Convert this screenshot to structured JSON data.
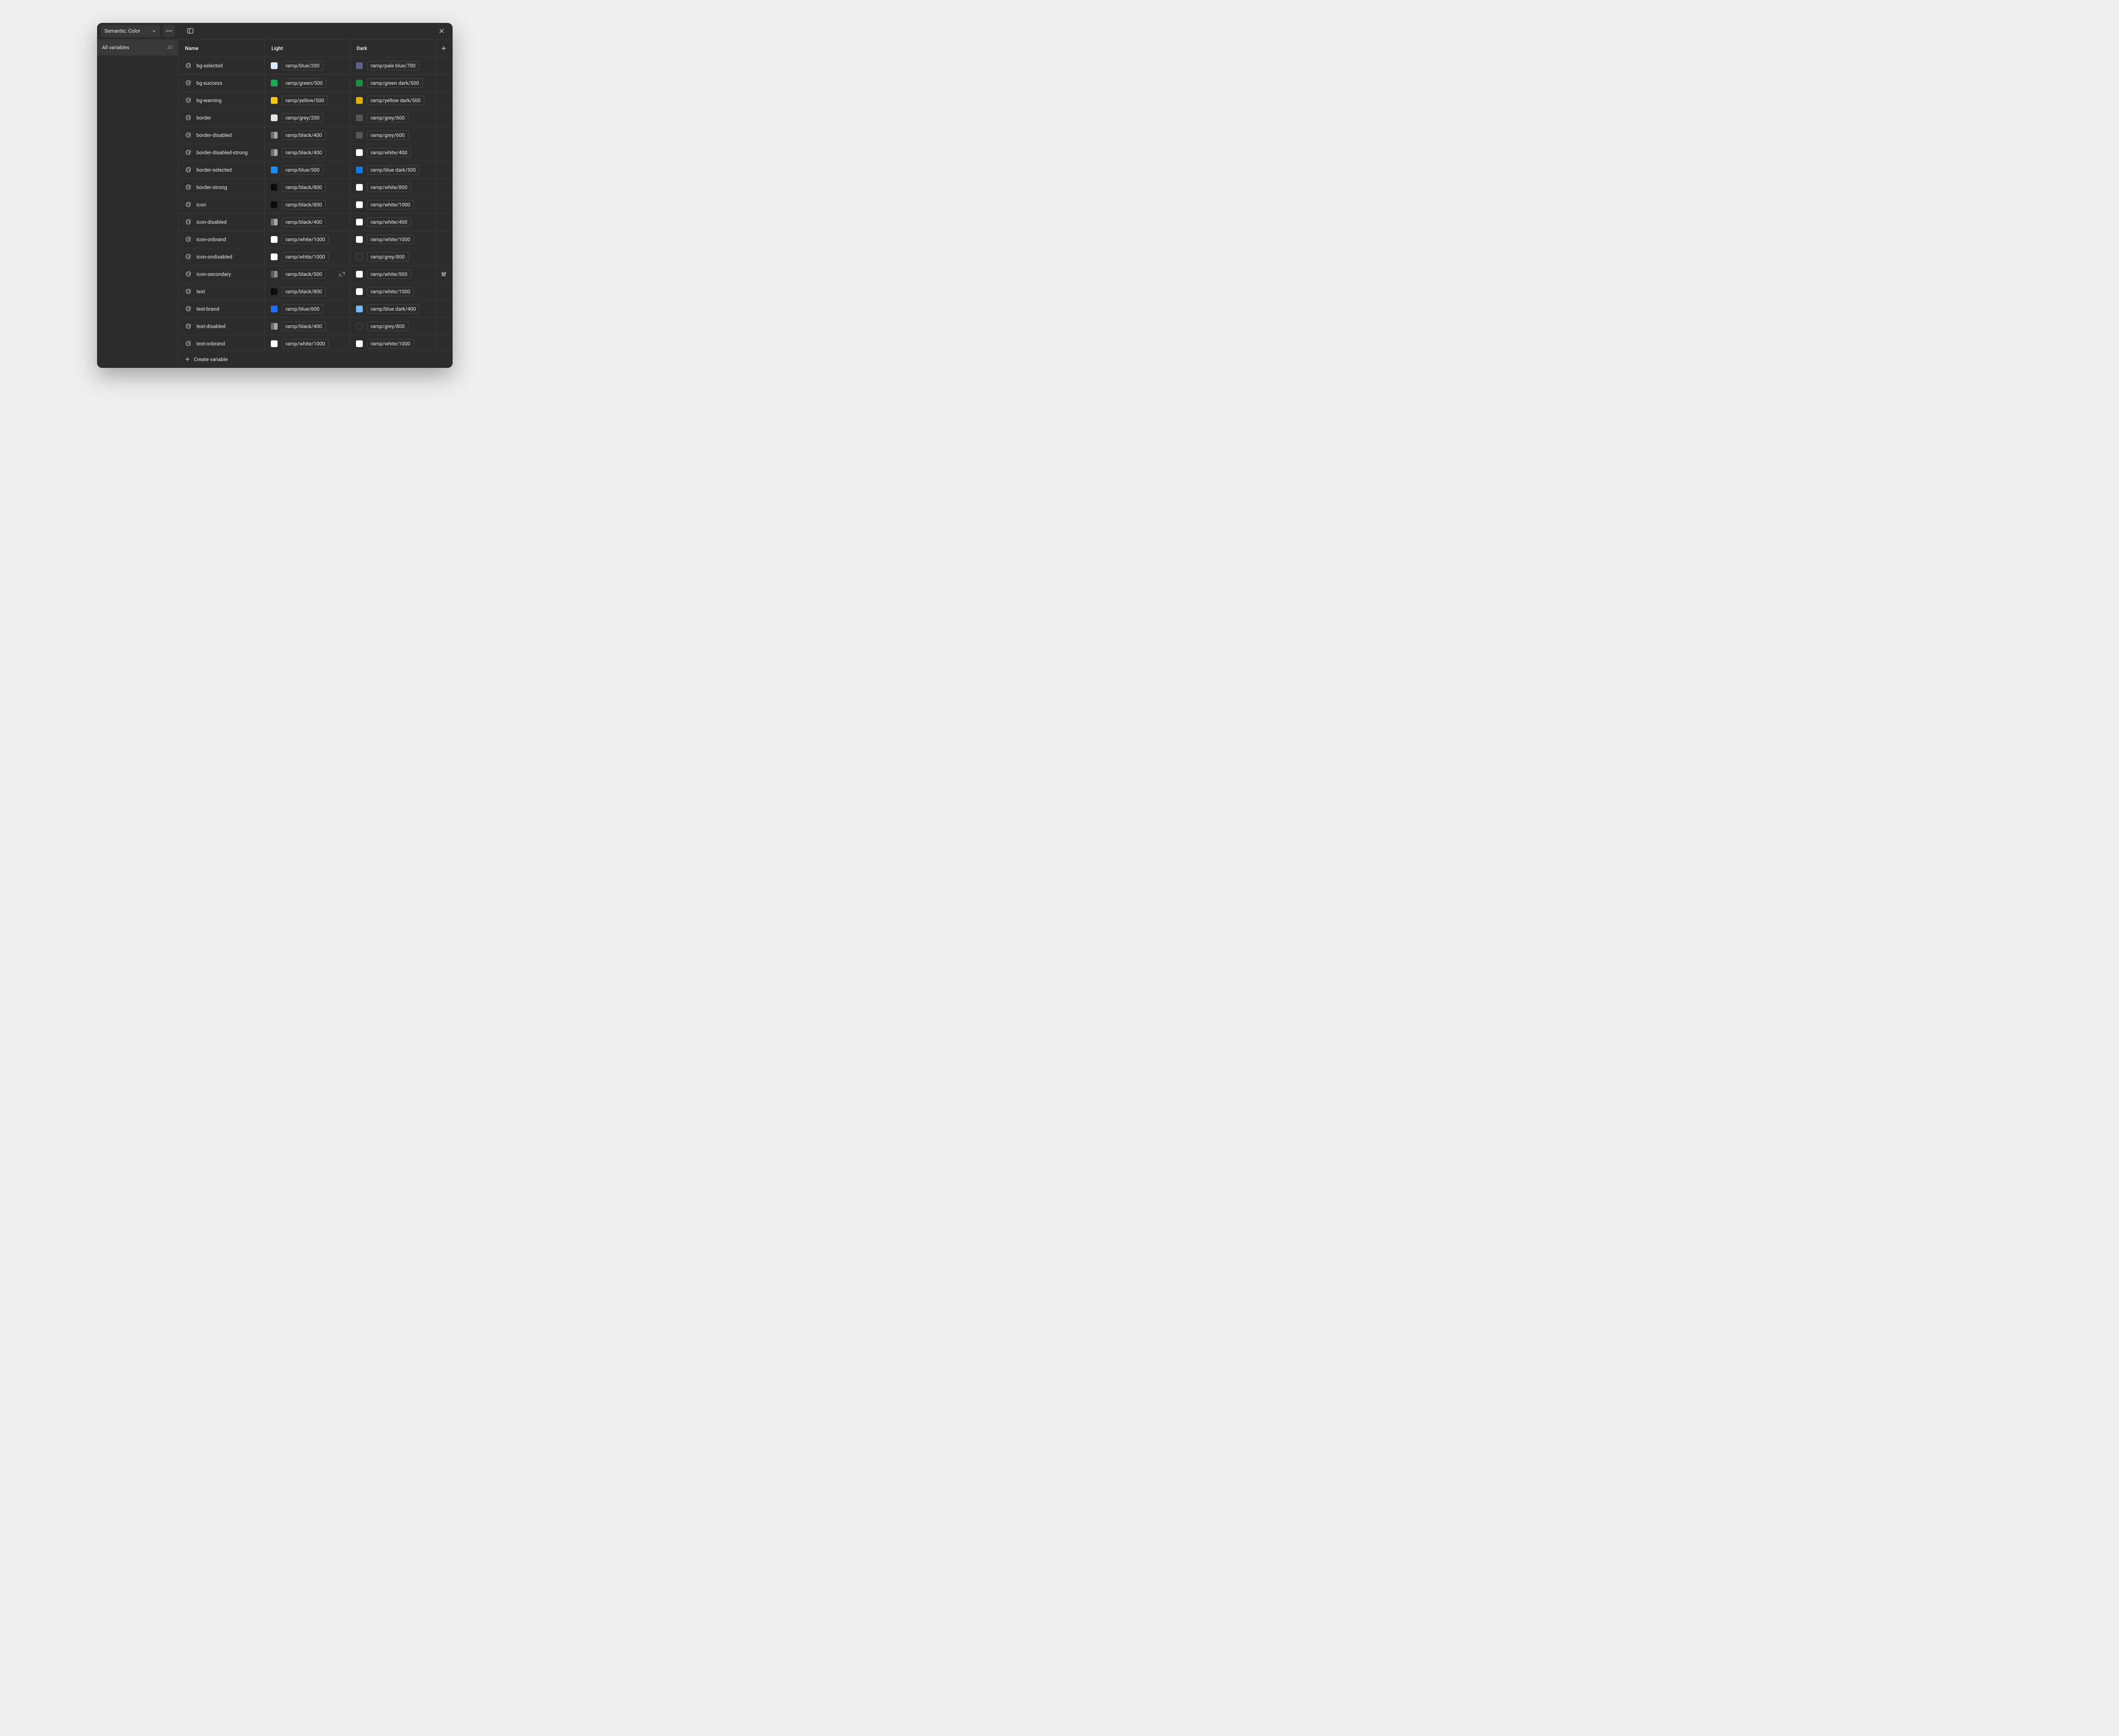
{
  "collection": {
    "label": "Semantic: Color"
  },
  "sidebar": {
    "all_label": "All variables",
    "all_count": "30"
  },
  "columns": {
    "name": "Name",
    "light": "Light",
    "dark": "Dark"
  },
  "footer": {
    "create_label": "Create variable"
  },
  "rows": [
    {
      "name": "bg-selected",
      "light": {
        "pill": "ramp/blue/200",
        "swatch": "#dbe9ff"
      },
      "dark": {
        "pill": "ramp/pale blue/700",
        "swatch": "#5a6386"
      }
    },
    {
      "name": "bg-success",
      "light": {
        "pill": "ramp/green/500",
        "swatch": "#18a957"
      },
      "dark": {
        "pill": "ramp/green dark/500",
        "swatch": "#1f8c4b"
      }
    },
    {
      "name": "bg-warning",
      "light": {
        "pill": "ramp/yellow/500",
        "swatch": "#f5c518"
      },
      "dark": {
        "pill": "ramp/yellow dark/500",
        "swatch": "#e0b100"
      }
    },
    {
      "name": "border",
      "light": {
        "pill": "ramp/grey/200",
        "swatch": "#e3e3e3"
      },
      "dark": {
        "pill": "ramp/grey/600",
        "swatch": "#555555"
      }
    },
    {
      "name": "border-disabled",
      "light": {
        "pill": "ramp/black/400",
        "swatch": "#a8a8a8",
        "half": true
      },
      "dark": {
        "pill": "ramp/grey/600",
        "swatch": "#555555"
      }
    },
    {
      "name": "border-disabled-strong",
      "light": {
        "pill": "ramp/black/400",
        "swatch": "#a8a8a8",
        "half": true
      },
      "dark": {
        "pill": "ramp/white/400",
        "swatch": "#ffffff"
      }
    },
    {
      "name": "border-selected",
      "light": {
        "pill": "ramp/blue/500",
        "swatch": "#1b8cff"
      },
      "dark": {
        "pill": "ramp/blue dark/500",
        "swatch": "#0d7be6"
      }
    },
    {
      "name": "border-strong",
      "light": {
        "pill": "ramp/black/800",
        "swatch": "#101010",
        "half": true
      },
      "dark": {
        "pill": "ramp/white/800",
        "swatch": "#ffffff"
      }
    },
    {
      "name": "icon",
      "light": {
        "pill": "ramp/black/800",
        "swatch": "#101010",
        "half": true
      },
      "dark": {
        "pill": "ramp/white/1000",
        "swatch": "#ffffff"
      }
    },
    {
      "name": "icon-disabled",
      "light": {
        "pill": "ramp/black/400",
        "swatch": "#a8a8a8",
        "half": true
      },
      "dark": {
        "pill": "ramp/white/400",
        "swatch": "#ffffff"
      }
    },
    {
      "name": "icon-onbrand",
      "light": {
        "pill": "ramp/white/1000",
        "swatch": "#ffffff"
      },
      "dark": {
        "pill": "ramp/white/1000",
        "swatch": "#ffffff"
      }
    },
    {
      "name": "icon-ondisabled",
      "light": {
        "pill": "ramp/white/1000",
        "swatch": "#ffffff"
      },
      "dark": {
        "pill": "ramp/grey/800",
        "hollow": true
      }
    },
    {
      "name": "icon-secondary",
      "light": {
        "pill": "ramp/black/500",
        "swatch": "#8a8a8a",
        "half": true,
        "detach": true
      },
      "dark": {
        "pill": "ramp/white/500",
        "swatch": "#ffffff",
        "settings": true
      }
    },
    {
      "name": "text",
      "light": {
        "pill": "ramp/black/800",
        "swatch": "#101010",
        "half": true
      },
      "dark": {
        "pill": "ramp/white/1000",
        "swatch": "#ffffff"
      }
    },
    {
      "name": "text-brand",
      "light": {
        "pill": "ramp/blue/600",
        "swatch": "#1f6ef0"
      },
      "dark": {
        "pill": "ramp/blue dark/400",
        "swatch": "#7ab8f5"
      }
    },
    {
      "name": "text-disabled",
      "light": {
        "pill": "ramp/black/400",
        "swatch": "#a8a8a8",
        "half": true
      },
      "dark": {
        "pill": "ramp/grey/800",
        "hollow": true
      }
    },
    {
      "name": "text-onbrand",
      "light": {
        "pill": "ramp/white/1000",
        "swatch": "#ffffff"
      },
      "dark": {
        "pill": "ramp/white/1000",
        "swatch": "#ffffff"
      }
    }
  ]
}
